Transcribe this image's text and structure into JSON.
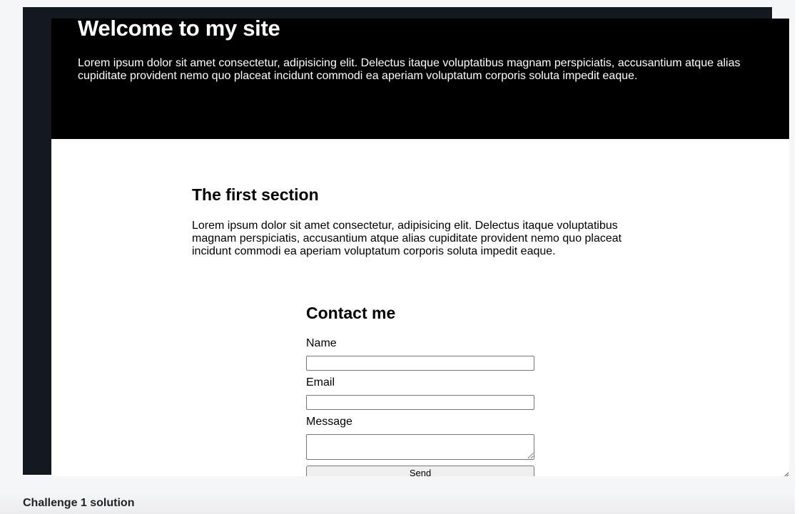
{
  "hero": {
    "title": "Welcome to my site",
    "text": "Lorem ipsum dolor sit amet consectetur, adipisicing elit. Delectus itaque voluptatibus magnam perspiciatis, accusantium atque alias cupiditate provident nemo quo placeat incidunt commodi ea aperiam voluptatum corporis soluta impedit eaque."
  },
  "section": {
    "title": "The first section",
    "text": "Lorem ipsum dolor sit amet consectetur, adipisicing elit. Delectus itaque voluptatibus magnam perspiciatis, accusantium atque alias cupiditate provident nemo quo placeat incidunt commodi ea aperiam voluptatum corporis soluta impedit eaque."
  },
  "contact": {
    "title": "Contact me",
    "name_label": "Name",
    "name_value": "",
    "email_label": "Email",
    "email_value": "",
    "message_label": "Message",
    "message_value": "",
    "send_label": "Send"
  },
  "footer": {
    "title": "Challenge 1 solution"
  },
  "icons": {
    "resize_grip": "resize-grip-icon"
  },
  "colors": {
    "hero_background": "#000000",
    "frame_border": "#141920",
    "page_background": "#f5f6f8"
  }
}
